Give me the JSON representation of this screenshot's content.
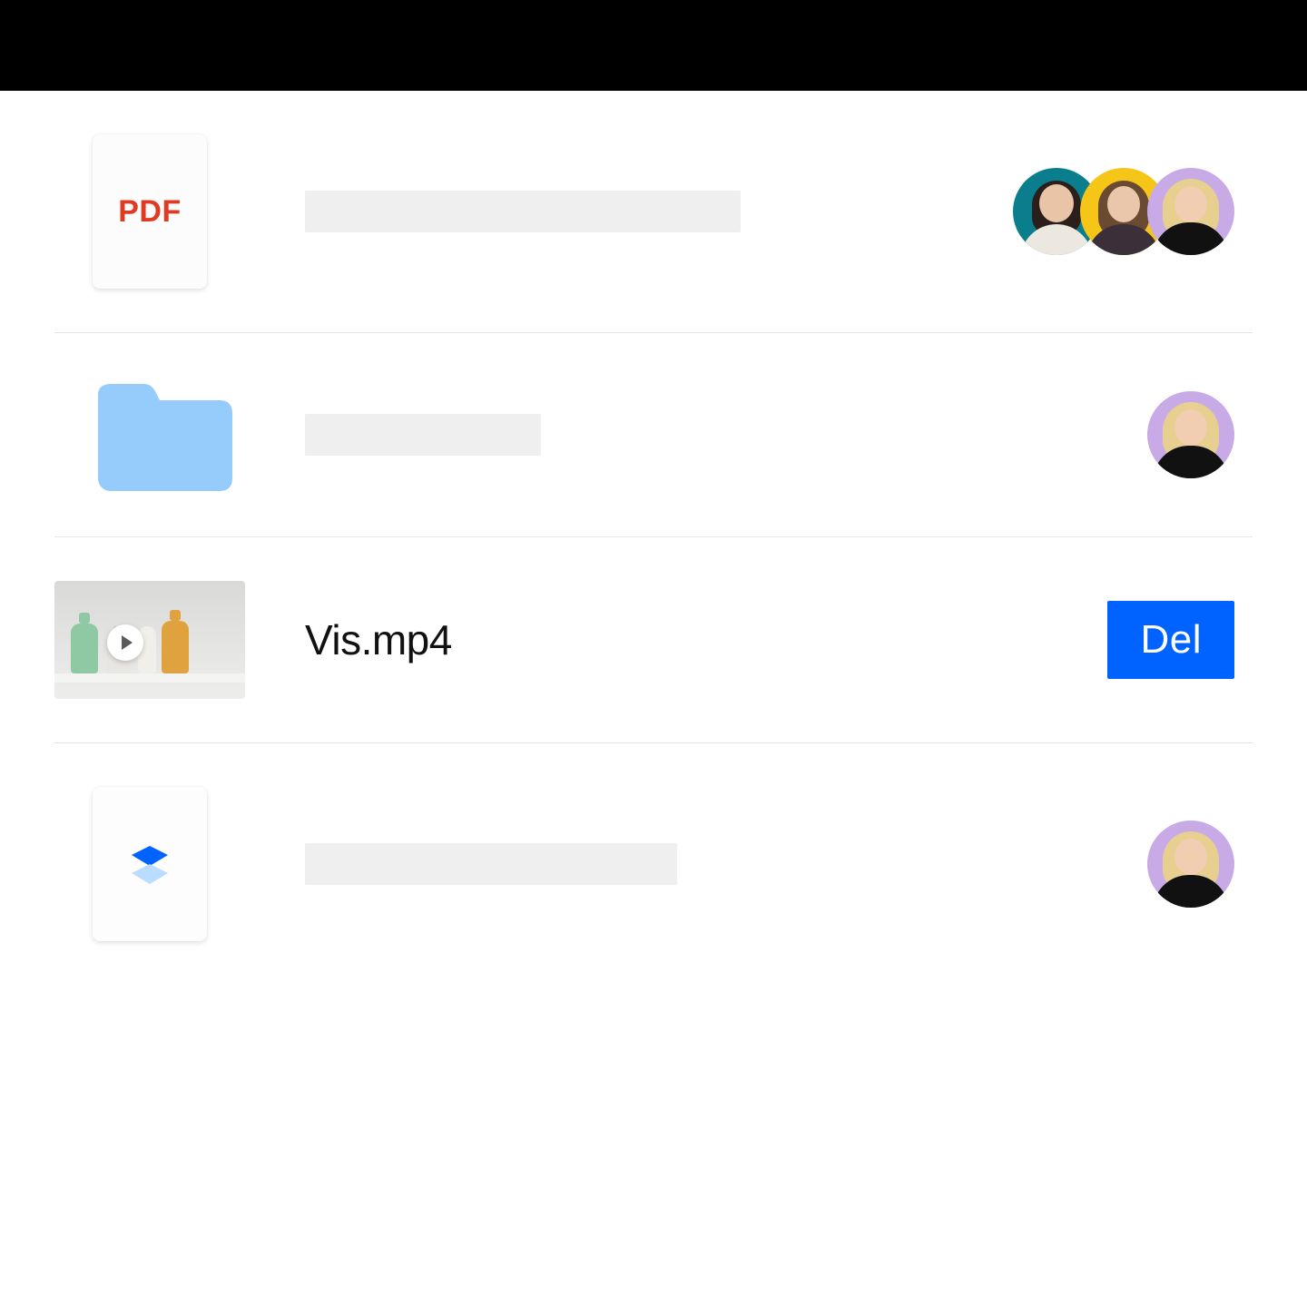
{
  "rows": [
    {
      "type": "pdf",
      "pdf_label": "PDF",
      "name_placeholder": true,
      "avatars": [
        {
          "bg": "teal",
          "person": "p1",
          "alt": "Collaborator 1"
        },
        {
          "bg": "yellow",
          "person": "p2",
          "alt": "Collaborator 2"
        },
        {
          "bg": "lilac",
          "person": "p3",
          "alt": "Collaborator 3"
        }
      ]
    },
    {
      "type": "folder",
      "name_placeholder": true,
      "avatars": [
        {
          "bg": "lilac",
          "person": "p3",
          "alt": "Collaborator"
        }
      ]
    },
    {
      "type": "video",
      "name": "Vis.mp4",
      "action_label": "Del"
    },
    {
      "type": "paper",
      "name_placeholder": true,
      "avatars": [
        {
          "bg": "lilac",
          "person": "p3",
          "alt": "Collaborator"
        }
      ]
    }
  ],
  "colors": {
    "pdf_red": "#e03b22",
    "folder_blue": "#96ccfb",
    "accent_blue": "#0062ff"
  }
}
